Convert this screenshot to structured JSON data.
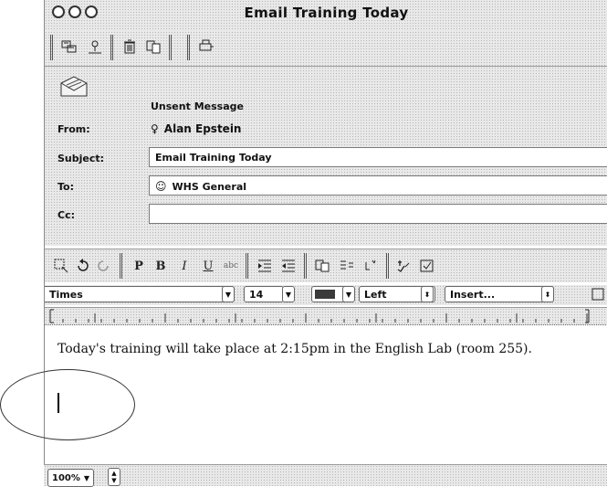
{
  "window": {
    "title": "Email Training Today"
  },
  "header": {
    "status": "Unsent Message",
    "from_label": "From:",
    "from_value": "Alan Epstein",
    "subject_label": "Subject:",
    "subject_value": "Email Training Today",
    "to_label": "To:",
    "to_value": "WHS General",
    "cc_label": "Cc:",
    "cc_value": ""
  },
  "format_toolbar": {
    "plain": "P",
    "bold": "B",
    "italic": "I",
    "underline": "U"
  },
  "format_row": {
    "font": "Times",
    "size": "14",
    "align": "Left",
    "insert": "Insert..."
  },
  "message": {
    "body": "Today's training will take place at 2:15pm in the English Lab (room 255)."
  },
  "statusbar": {
    "zoom": "100%"
  }
}
